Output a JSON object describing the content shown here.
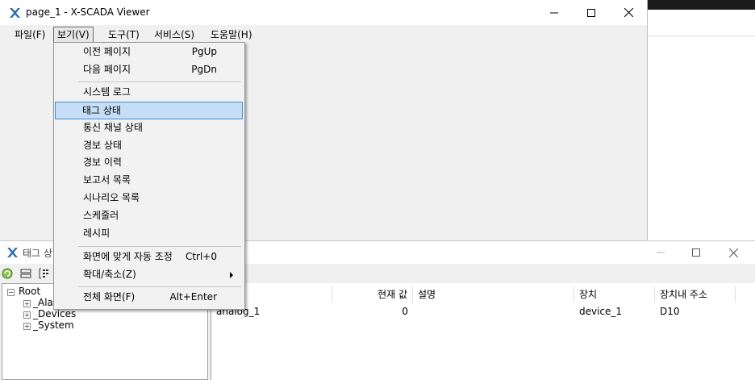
{
  "main_window": {
    "title": "page_1 - X-SCADA Viewer",
    "menu": [
      "파일(F)",
      "보기(V)",
      "도구(T)",
      "서비스(S)",
      "도움말(H)"
    ]
  },
  "view_menu": {
    "items": [
      {
        "label": "이전 페이지",
        "shortcut": "PgUp"
      },
      {
        "label": "다음 페이지",
        "shortcut": "PgDn"
      },
      {
        "label": "시스템 로그",
        "shortcut": ""
      },
      {
        "label": "태그 상태",
        "shortcut": "",
        "highlighted": true
      },
      {
        "label": "통신 채널 상태",
        "shortcut": ""
      },
      {
        "label": "경보 상태",
        "shortcut": ""
      },
      {
        "label": "경보 이력",
        "shortcut": ""
      },
      {
        "label": "보고서 목록",
        "shortcut": ""
      },
      {
        "label": "시나리오 목록",
        "shortcut": ""
      },
      {
        "label": "스케줄러",
        "shortcut": ""
      },
      {
        "label": "레시피",
        "shortcut": ""
      },
      {
        "label": "화면에 맞게 자동 조정",
        "shortcut": "Ctrl+0"
      },
      {
        "label": "확대/축소(Z)",
        "shortcut": "",
        "submenu": true
      },
      {
        "label": "전체 화면(F)",
        "shortcut": "Alt+Enter"
      }
    ]
  },
  "tag_window": {
    "title": "태그 상",
    "tree": {
      "root": "Root",
      "children": [
        "_Ala",
        "_Devices",
        "_System"
      ]
    },
    "columns": [
      "",
      "현재 값",
      "설명",
      "장치",
      "장치내 주소"
    ],
    "rows": [
      {
        "name": "analog_1",
        "value": "0",
        "description": "",
        "device": "device_1",
        "address": "D10"
      }
    ]
  },
  "colors": {
    "highlight_bg": "#c6def5",
    "highlight_border": "#3d8fd6",
    "app_icon": "#2b6cb0"
  }
}
